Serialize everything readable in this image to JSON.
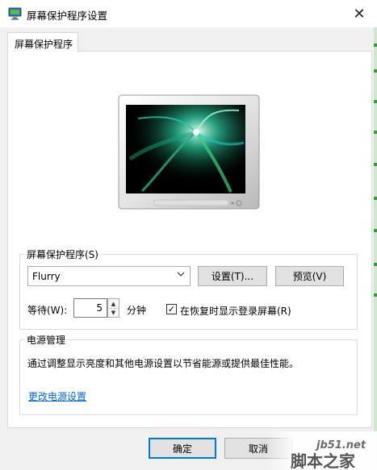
{
  "window": {
    "title": "屏幕保护程序设置",
    "close_glyph": "✕",
    "accent": "#0078d7"
  },
  "tabs": [
    {
      "label": "屏幕保护程序",
      "selected": true
    }
  ],
  "screensaver": {
    "group_label": "屏幕保护程序(S)",
    "selected": "Flurry",
    "settings_label": "设置(T)...",
    "preview_label": "预览(V)",
    "wait_label": "等待(W):",
    "wait_value": "5",
    "minutes_label": "分钟",
    "resume_checked": true,
    "resume_label": "在恢复时显示登录屏幕(R)"
  },
  "power": {
    "group_label": "电源管理",
    "description": "通过调整显示亮度和其他电源设置以节省能源或提供最佳性能。",
    "link_label": "更改电源设置"
  },
  "dialog_buttons": {
    "ok_label": "确定",
    "cancel_label": "取消"
  },
  "watermark": {
    "site": "jb51.net",
    "name": "脚本之家"
  },
  "icons": {
    "app": "display-settings-icon",
    "dropdown": "chevron-down-icon",
    "check": "checkmark-icon"
  }
}
